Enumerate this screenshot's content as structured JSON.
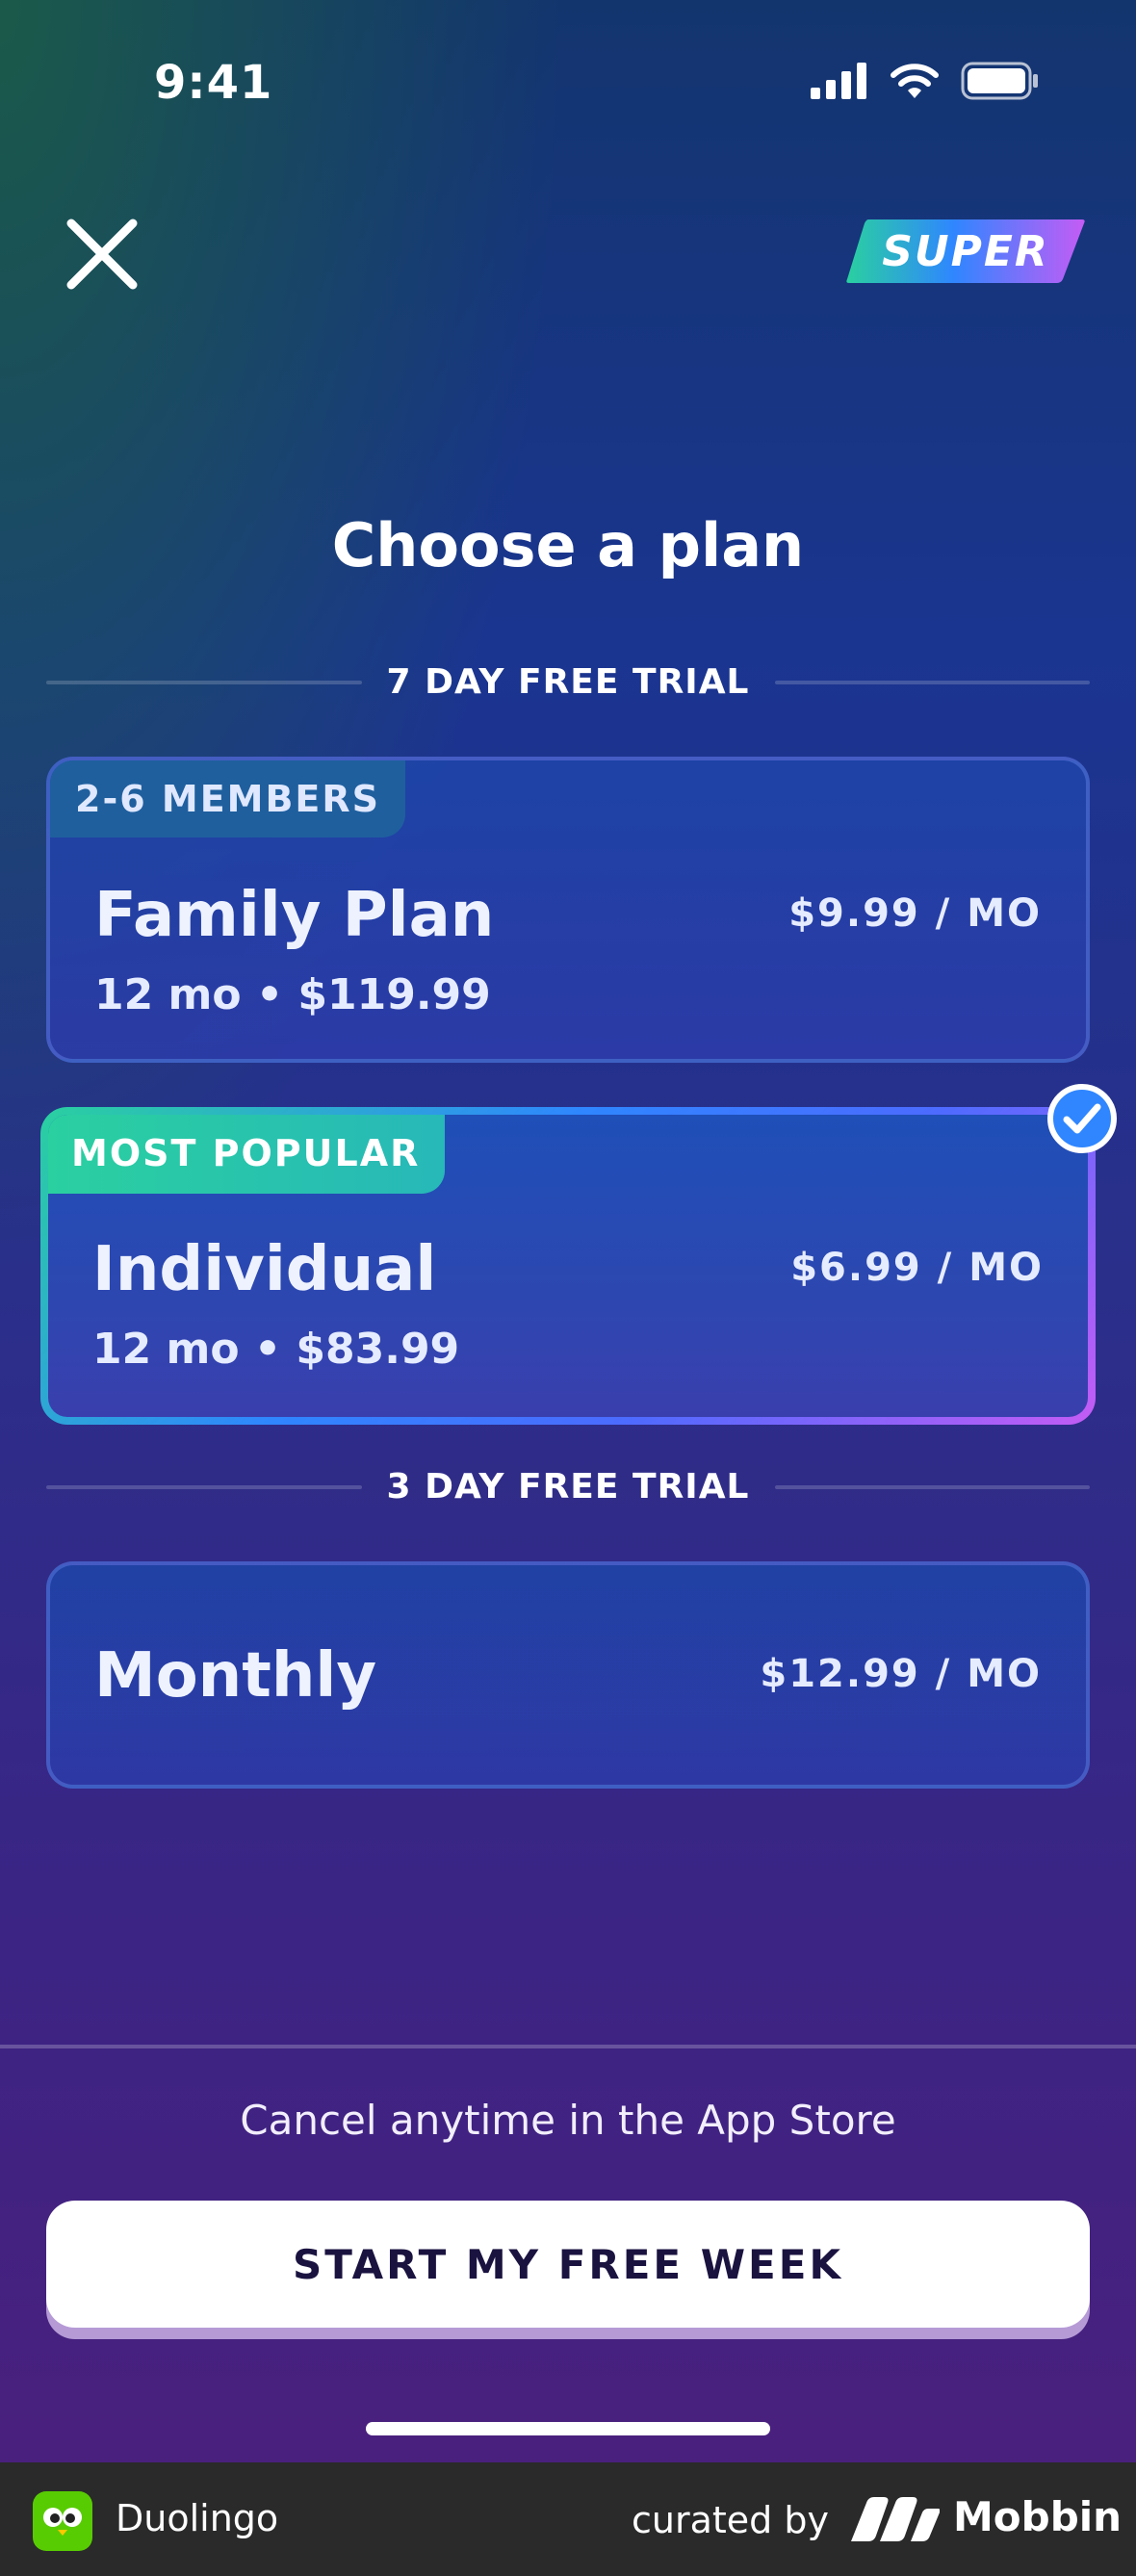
{
  "status_bar": {
    "time": "9:41"
  },
  "header": {
    "badge_label": "SUPER"
  },
  "title": "Choose a plan",
  "sections": [
    {
      "label": "7 DAY FREE TRIAL"
    },
    {
      "label": "3 DAY FREE TRIAL"
    }
  ],
  "plans": [
    {
      "tag": "2-6 MEMBERS",
      "name": "Family Plan",
      "detail": "12 mo • $119.99",
      "price": "$9.99 / MO",
      "selected": false
    },
    {
      "tag": "MOST POPULAR",
      "name": "Individual",
      "detail": "12 mo • $83.99",
      "price": "$6.99 / MO",
      "selected": true
    },
    {
      "tag": "",
      "name": "Monthly",
      "detail": "",
      "price": "$12.99 / MO",
      "selected": false
    }
  ],
  "footer": {
    "cancel_note": "Cancel anytime in the App Store",
    "cta_label": "START MY FREE WEEK"
  },
  "attribution": {
    "app_name": "Duolingo",
    "curated_by": "curated by",
    "brand": "Mobbin"
  },
  "colors": {
    "accent_green": "#2ad0a0",
    "accent_blue": "#2f86ff",
    "accent_pink": "#c45cf5",
    "duolingo_green": "#58cc02"
  }
}
